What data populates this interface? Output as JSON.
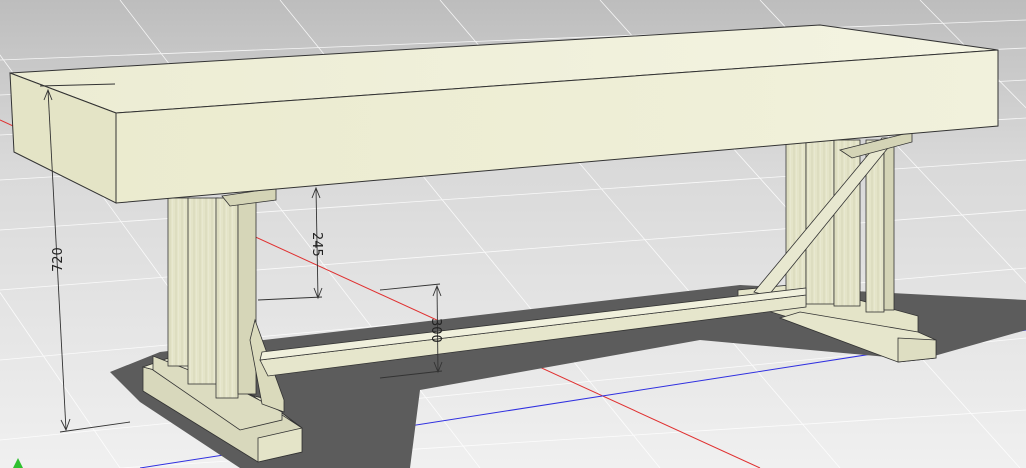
{
  "viewport": {
    "background_top": "#bcbcbc",
    "background_bottom": "#efefef"
  },
  "colors": {
    "wood_light": "#efefd9",
    "wood_mid": "#e2e2c6",
    "wood_dark": "#c9c9ab",
    "shadow": "#5c5c5c",
    "grid": "#ffffff",
    "axis_red": "#e03030",
    "axis_blue": "#3030e0",
    "axis_green": "#30c030",
    "dimension_line": "#333333"
  },
  "dimensions": {
    "overall_height": "720",
    "clearance_under_top": "245",
    "stretcher_height": "300"
  }
}
